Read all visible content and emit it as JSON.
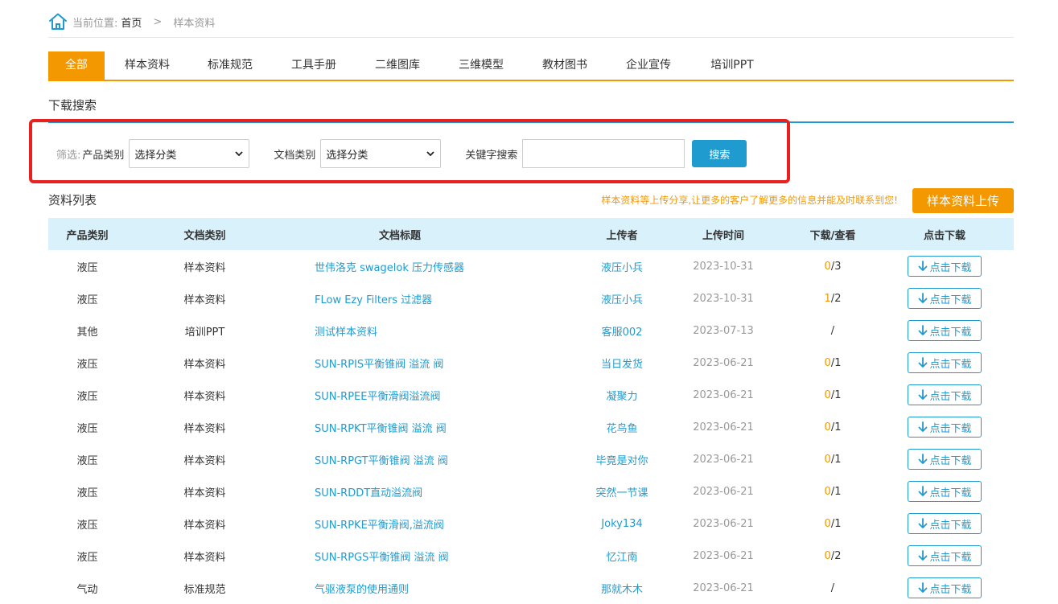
{
  "breadcrumb": {
    "label": "当前位置:",
    "home": "首页",
    "separator": ">",
    "current": "样本资料"
  },
  "tabs": [
    {
      "label": "全部",
      "active": true
    },
    {
      "label": "样本资料",
      "active": false
    },
    {
      "label": "标准规范",
      "active": false
    },
    {
      "label": "工具手册",
      "active": false
    },
    {
      "label": "二维图库",
      "active": false
    },
    {
      "label": "三维模型",
      "active": false
    },
    {
      "label": "教材图书",
      "active": false
    },
    {
      "label": "企业宣传",
      "active": false
    },
    {
      "label": "培训PPT",
      "active": false
    }
  ],
  "search": {
    "title": "下载搜索",
    "filter_label": "筛选:",
    "product_label": "产品类别",
    "product_value": "选择分类",
    "doc_label": "文档类别",
    "doc_value": "选择分类",
    "keyword_label": "关键字搜索",
    "keyword_value": "",
    "button": "搜索"
  },
  "list": {
    "title": "资料列表",
    "notice": "样本资料等上传分享,让更多的客户了解更多的信息并能及时联系到您!",
    "upload_button": "样本资料上传",
    "headers": {
      "product": "产品类别",
      "doc": "文档类别",
      "title": "文档标题",
      "uploader": "上传者",
      "time": "上传时间",
      "stats": "下载/查看",
      "action": "点击下载"
    },
    "download_label": "点击下载",
    "rows": [
      {
        "product": "液压",
        "doc": "样本资料",
        "title": "世伟洛克 swagelok 压力传感器",
        "uploader": "液压小兵",
        "time": "2023-10-31",
        "downloads": "0",
        "views": "/3"
      },
      {
        "product": "液压",
        "doc": "样本资料",
        "title": "FLow Ezy Filters 过滤器",
        "uploader": "液压小兵",
        "time": "2023-10-31",
        "downloads": "1",
        "views": "/2"
      },
      {
        "product": "其他",
        "doc": "培训PPT",
        "title": "测试样本资料",
        "uploader": "客服002",
        "time": "2023-07-13",
        "downloads": "",
        "views": "/"
      },
      {
        "product": "液压",
        "doc": "样本资料",
        "title": "SUN-RPIS平衡锥阀 溢流 阀",
        "uploader": "当日发货",
        "time": "2023-06-21",
        "downloads": "0",
        "views": "/1"
      },
      {
        "product": "液压",
        "doc": "样本资料",
        "title": "SUN-RPEE平衡滑阀溢流阀",
        "uploader": "凝聚力",
        "time": "2023-06-21",
        "downloads": "0",
        "views": "/1"
      },
      {
        "product": "液压",
        "doc": "样本资料",
        "title": "SUN-RPKT平衡锥阀 溢流 阀",
        "uploader": "花鸟鱼",
        "time": "2023-06-21",
        "downloads": "0",
        "views": "/1"
      },
      {
        "product": "液压",
        "doc": "样本资料",
        "title": "SUN-RPGT平衡锥阀 溢流 阀",
        "uploader": "毕竟是对你",
        "time": "2023-06-21",
        "downloads": "0",
        "views": "/1"
      },
      {
        "product": "液压",
        "doc": "样本资料",
        "title": "SUN-RDDT直动溢流阀",
        "uploader": "突然一节课",
        "time": "2023-06-21",
        "downloads": "0",
        "views": "/1"
      },
      {
        "product": "液压",
        "doc": "样本资料",
        "title": "SUN-RPKE平衡滑阀,溢流阀",
        "uploader": "Joky134",
        "time": "2023-06-21",
        "downloads": "0",
        "views": "/1"
      },
      {
        "product": "液压",
        "doc": "样本资料",
        "title": "SUN-RPGS平衡锥阀 溢流 阀",
        "uploader": "忆江南",
        "time": "2023-06-21",
        "downloads": "0",
        "views": "/2"
      },
      {
        "product": "气动",
        "doc": "标准规范",
        "title": "气驱液泵的使用通则",
        "uploader": "那就木木",
        "time": "2023-06-21",
        "downloads": "",
        "views": "/"
      }
    ]
  },
  "colors": {
    "accent_orange": "#f39800",
    "accent_blue": "#1f9bcf",
    "header_bg": "#d9f1fb",
    "highlight_red": "#e8201f"
  },
  "icons": {
    "home": "home-icon",
    "select": "chevron-down-icon",
    "download": "arrow-down-icon"
  }
}
